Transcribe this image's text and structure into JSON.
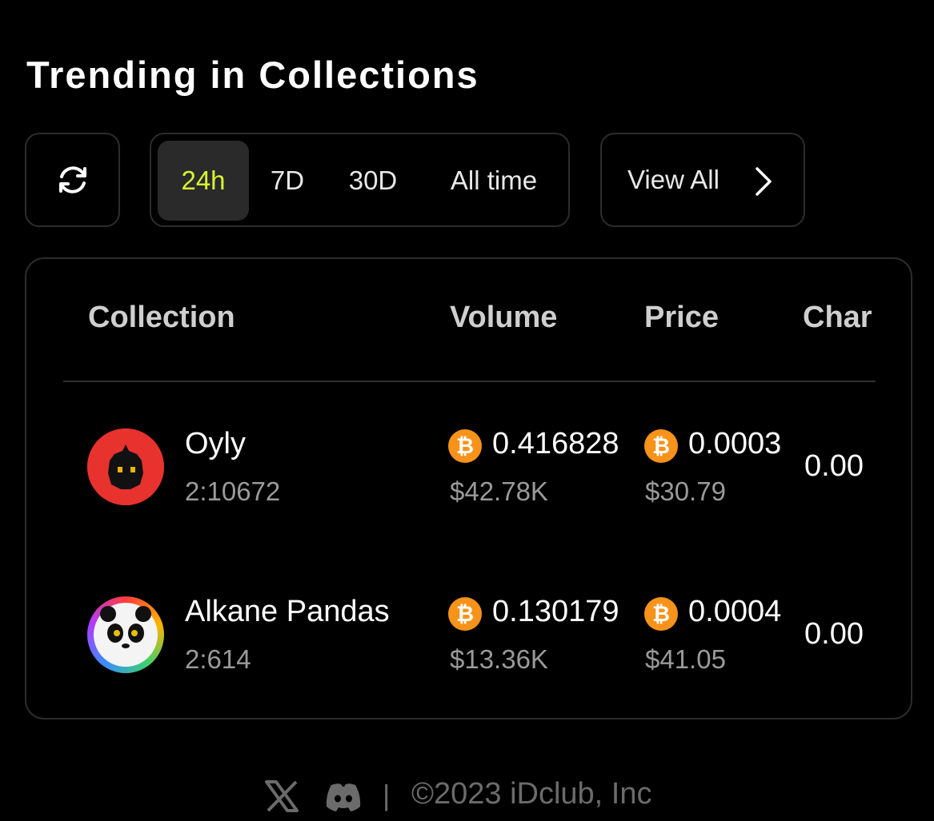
{
  "header": {
    "title": "Trending in Collections"
  },
  "controls": {
    "refresh_icon": "refresh-icon",
    "tabs": [
      {
        "label": "24h",
        "active": true
      },
      {
        "label": "7D",
        "active": false
      },
      {
        "label": "30D",
        "active": false
      },
      {
        "label": "All time",
        "active": false
      }
    ],
    "view_all_label": "View All",
    "active_color": "#d7f531"
  },
  "table": {
    "columns": [
      "Collection",
      "Volume",
      "Price",
      "Char"
    ],
    "rows": [
      {
        "name": "Oyly",
        "id": "2:10672",
        "volume_btc": "0.416828",
        "volume_usd": "$42.78K",
        "price_btc": "0.0003",
        "price_usd": "$30.79",
        "change": "0.00"
      },
      {
        "name": "Alkane Pandas",
        "id": "2:614",
        "volume_btc": "0.130179",
        "volume_usd": "$13.36K",
        "price_btc": "0.0004",
        "price_usd": "$41.05",
        "change": "0.00"
      }
    ],
    "btc_symbol": "₿",
    "btc_color": "#f7931a"
  },
  "footer": {
    "separator": "|",
    "copyright": "©2023 iDclub, Inc",
    "icons": [
      "x-icon",
      "discord-icon"
    ]
  }
}
